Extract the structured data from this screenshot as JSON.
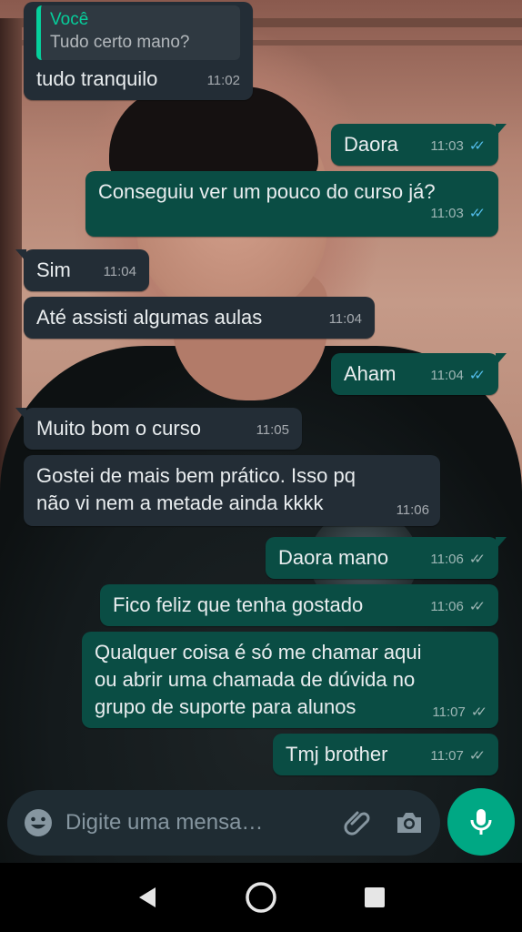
{
  "messages": [
    {
      "dir": "in",
      "quote_name": "Você",
      "quote_text": "Tudo certo mano?",
      "text": "tudo tranquilo",
      "time": "11:02"
    },
    {
      "dir": "out",
      "text": "Daora",
      "time": "11:03",
      "status": "read"
    },
    {
      "dir": "out",
      "text": "Conseguiu ver um pouco do curso já?",
      "time": "11:03",
      "status": "read"
    },
    {
      "dir": "in",
      "text": "Sim",
      "time": "11:04"
    },
    {
      "dir": "in",
      "text": "Até assisti algumas aulas",
      "time": "11:04"
    },
    {
      "dir": "out",
      "text": "Aham",
      "time": "11:04",
      "status": "read"
    },
    {
      "dir": "in",
      "text": "Muito bom o curso",
      "time": "11:05"
    },
    {
      "dir": "in",
      "text": "Gostei de mais bem prático. Isso pq\nnão vi nem a metade ainda kkkk",
      "time": "11:06"
    },
    {
      "dir": "out",
      "text": "Daora mano",
      "time": "11:06",
      "status": "delivered"
    },
    {
      "dir": "out",
      "text": "Fico feliz que tenha gostado",
      "time": "11:06",
      "status": "delivered"
    },
    {
      "dir": "out",
      "text": "Qualquer coisa é só me chamar aqui\nou abrir uma chamada de dúvida no\ngrupo de suporte para alunos",
      "time": "11:07",
      "status": "delivered"
    },
    {
      "dir": "out",
      "text": "Tmj brother",
      "time": "11:07",
      "status": "delivered"
    }
  ],
  "composer": {
    "placeholder": "Digite uma mensa…"
  },
  "icons": {
    "emoji": "emoji-icon",
    "attach": "paperclip-icon",
    "camera": "camera-icon",
    "mic": "microphone-icon",
    "back": "back-triangle-icon",
    "home": "home-circle-icon",
    "recents": "recents-square-icon"
  },
  "colors": {
    "incoming_bubble": "#232d36",
    "outgoing_bubble": "#0a4d44",
    "read_ticks": "#53bdeb",
    "accent": "#00a884",
    "quote_accent": "#06cf9c"
  }
}
